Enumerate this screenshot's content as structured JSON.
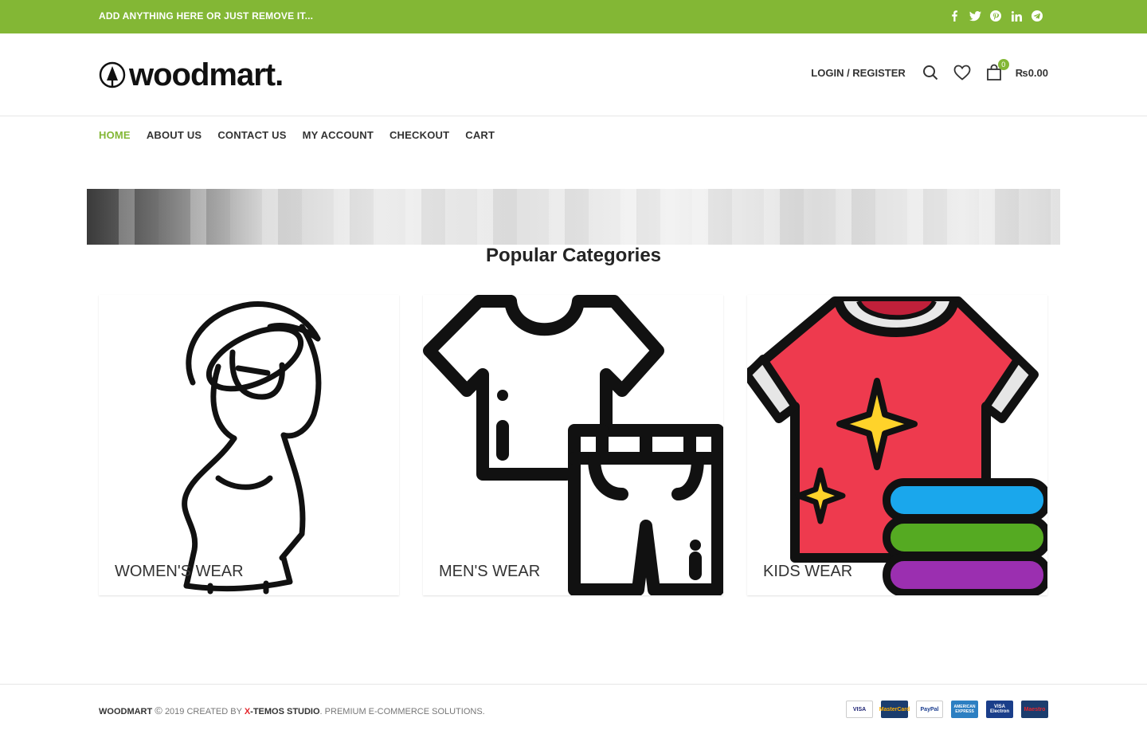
{
  "topbar": {
    "text": "ADD ANYTHING HERE OR JUST REMOVE IT...",
    "social_icons": [
      "facebook-icon",
      "twitter-icon",
      "pinterest-icon",
      "linkedin-icon",
      "telegram-icon"
    ]
  },
  "header": {
    "logo_text": "woodmart.",
    "login_label": "LOGIN / REGISTER",
    "cart_count": "0",
    "cart_total": "₨0.00"
  },
  "nav": {
    "items": [
      "HOME",
      "ABOUT US",
      "CONTACT US",
      "MY ACCOUNT",
      "CHECKOUT",
      "CART"
    ]
  },
  "section": {
    "title": "Popular Categories"
  },
  "categories": [
    {
      "label": "WOMEN'S WEAR",
      "icon": "woman-dress-icon"
    },
    {
      "label": "MEN'S WEAR",
      "icon": "shirt-pants-icon"
    },
    {
      "label": "KIDS WEAR",
      "icon": "kids-tshirt-icon"
    }
  ],
  "footer": {
    "brand": "WOODMART",
    "copyright": "2019 CREATED BY",
    "studio_x": "X",
    "studio_rest": "-TEMOS STUDIO",
    "tagline": ". PREMIUM E-COMMERCE SOLUTIONS.",
    "payments": [
      "VISA",
      "MasterCard",
      "PayPal",
      "AMERICAN EXPRESS",
      "VISA Electron",
      "Maestro"
    ]
  },
  "colors": {
    "accent": "#83b735",
    "red_badge": "#e4262c"
  }
}
